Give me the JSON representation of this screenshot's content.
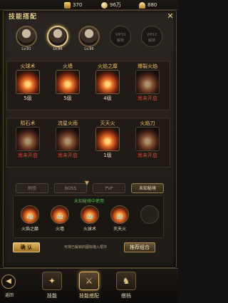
{
  "resources": {
    "gold": "370",
    "silver": "96万",
    "ingot": "880"
  },
  "header": {
    "title": "技能搭配",
    "close": "✕"
  },
  "heroes": [
    {
      "label": "Lv.91",
      "selected": false
    },
    {
      "label": "Lv.96",
      "selected": true
    },
    {
      "label": "Lv.96",
      "selected": false
    }
  ],
  "vips": [
    "VIP10\n解锁",
    "VIP12\n解锁"
  ],
  "skills_row1": [
    {
      "name": "火球术",
      "level": "5级",
      "locked": false
    },
    {
      "name": "火墙",
      "level": "5级",
      "locked": false
    },
    {
      "name": "火焰之靡",
      "level": "4级",
      "locked": false
    },
    {
      "name": "爆裂火焰",
      "level": "尚未开启",
      "locked": true
    }
  ],
  "skills_row2": [
    {
      "name": "陨石术",
      "level": "尚未开启",
      "locked": true
    },
    {
      "name": "流星火雨",
      "level": "尚未开启",
      "locked": true
    },
    {
      "name": "灭天火",
      "level": "1级",
      "locked": false
    },
    {
      "name": "火焰刀",
      "level": "尚未开启",
      "locked": true
    }
  ],
  "tabs": [
    "刷怪",
    "BOSS",
    "PVP",
    "未知秘境"
  ],
  "loadout": {
    "caption": "未知秘境中使用",
    "slots": [
      {
        "level": "4级",
        "name": "火焰之靡"
      },
      {
        "level": "5级",
        "name": "火墙"
      },
      {
        "level": "5级",
        "name": "火球术"
      },
      {
        "level": "1级",
        "name": "灭天火"
      },
      {
        "level": "",
        "name": ""
      }
    ]
  },
  "actions": {
    "confirm": "确 认",
    "hint": "可将已解锁的图标拖入框中",
    "recommend": "推荐组合"
  },
  "bottom_nav": {
    "back": "返回",
    "items": [
      "技能",
      "技能搭配",
      "搭档"
    ]
  }
}
